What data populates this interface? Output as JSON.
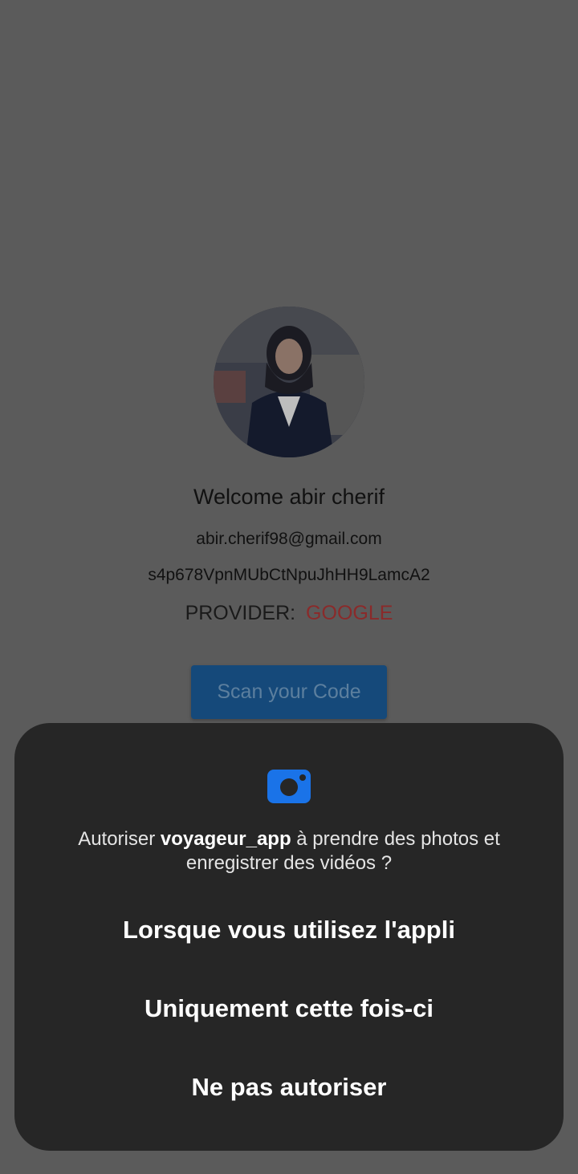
{
  "profile": {
    "avatar_alt": "profile photo",
    "welcome": "Welcome abir cherif",
    "email": "abir.cherif98@gmail.com",
    "uid": "s4p678VpnMUbCtNpuJhHH9LamcA2",
    "provider_label": "PROVIDER:",
    "provider_value": "GOOGLE"
  },
  "actions": {
    "scan_label": "Scan your Code"
  },
  "permission_dialog": {
    "icon": "camera-icon",
    "message_prefix": "Autoriser ",
    "app_name": "voyageur_app",
    "message_suffix": " à prendre des photos et enregistrer des vidéos ?",
    "options": [
      "Lorsque vous utilisez l'appli",
      "Uniquement cette fois-ci",
      "Ne pas autoriser"
    ]
  },
  "colors": {
    "scrim": "#5b5b5b",
    "sheet": "#262626",
    "accent_blue": "#1a73e8",
    "provider_red": "#8a2a2a"
  }
}
